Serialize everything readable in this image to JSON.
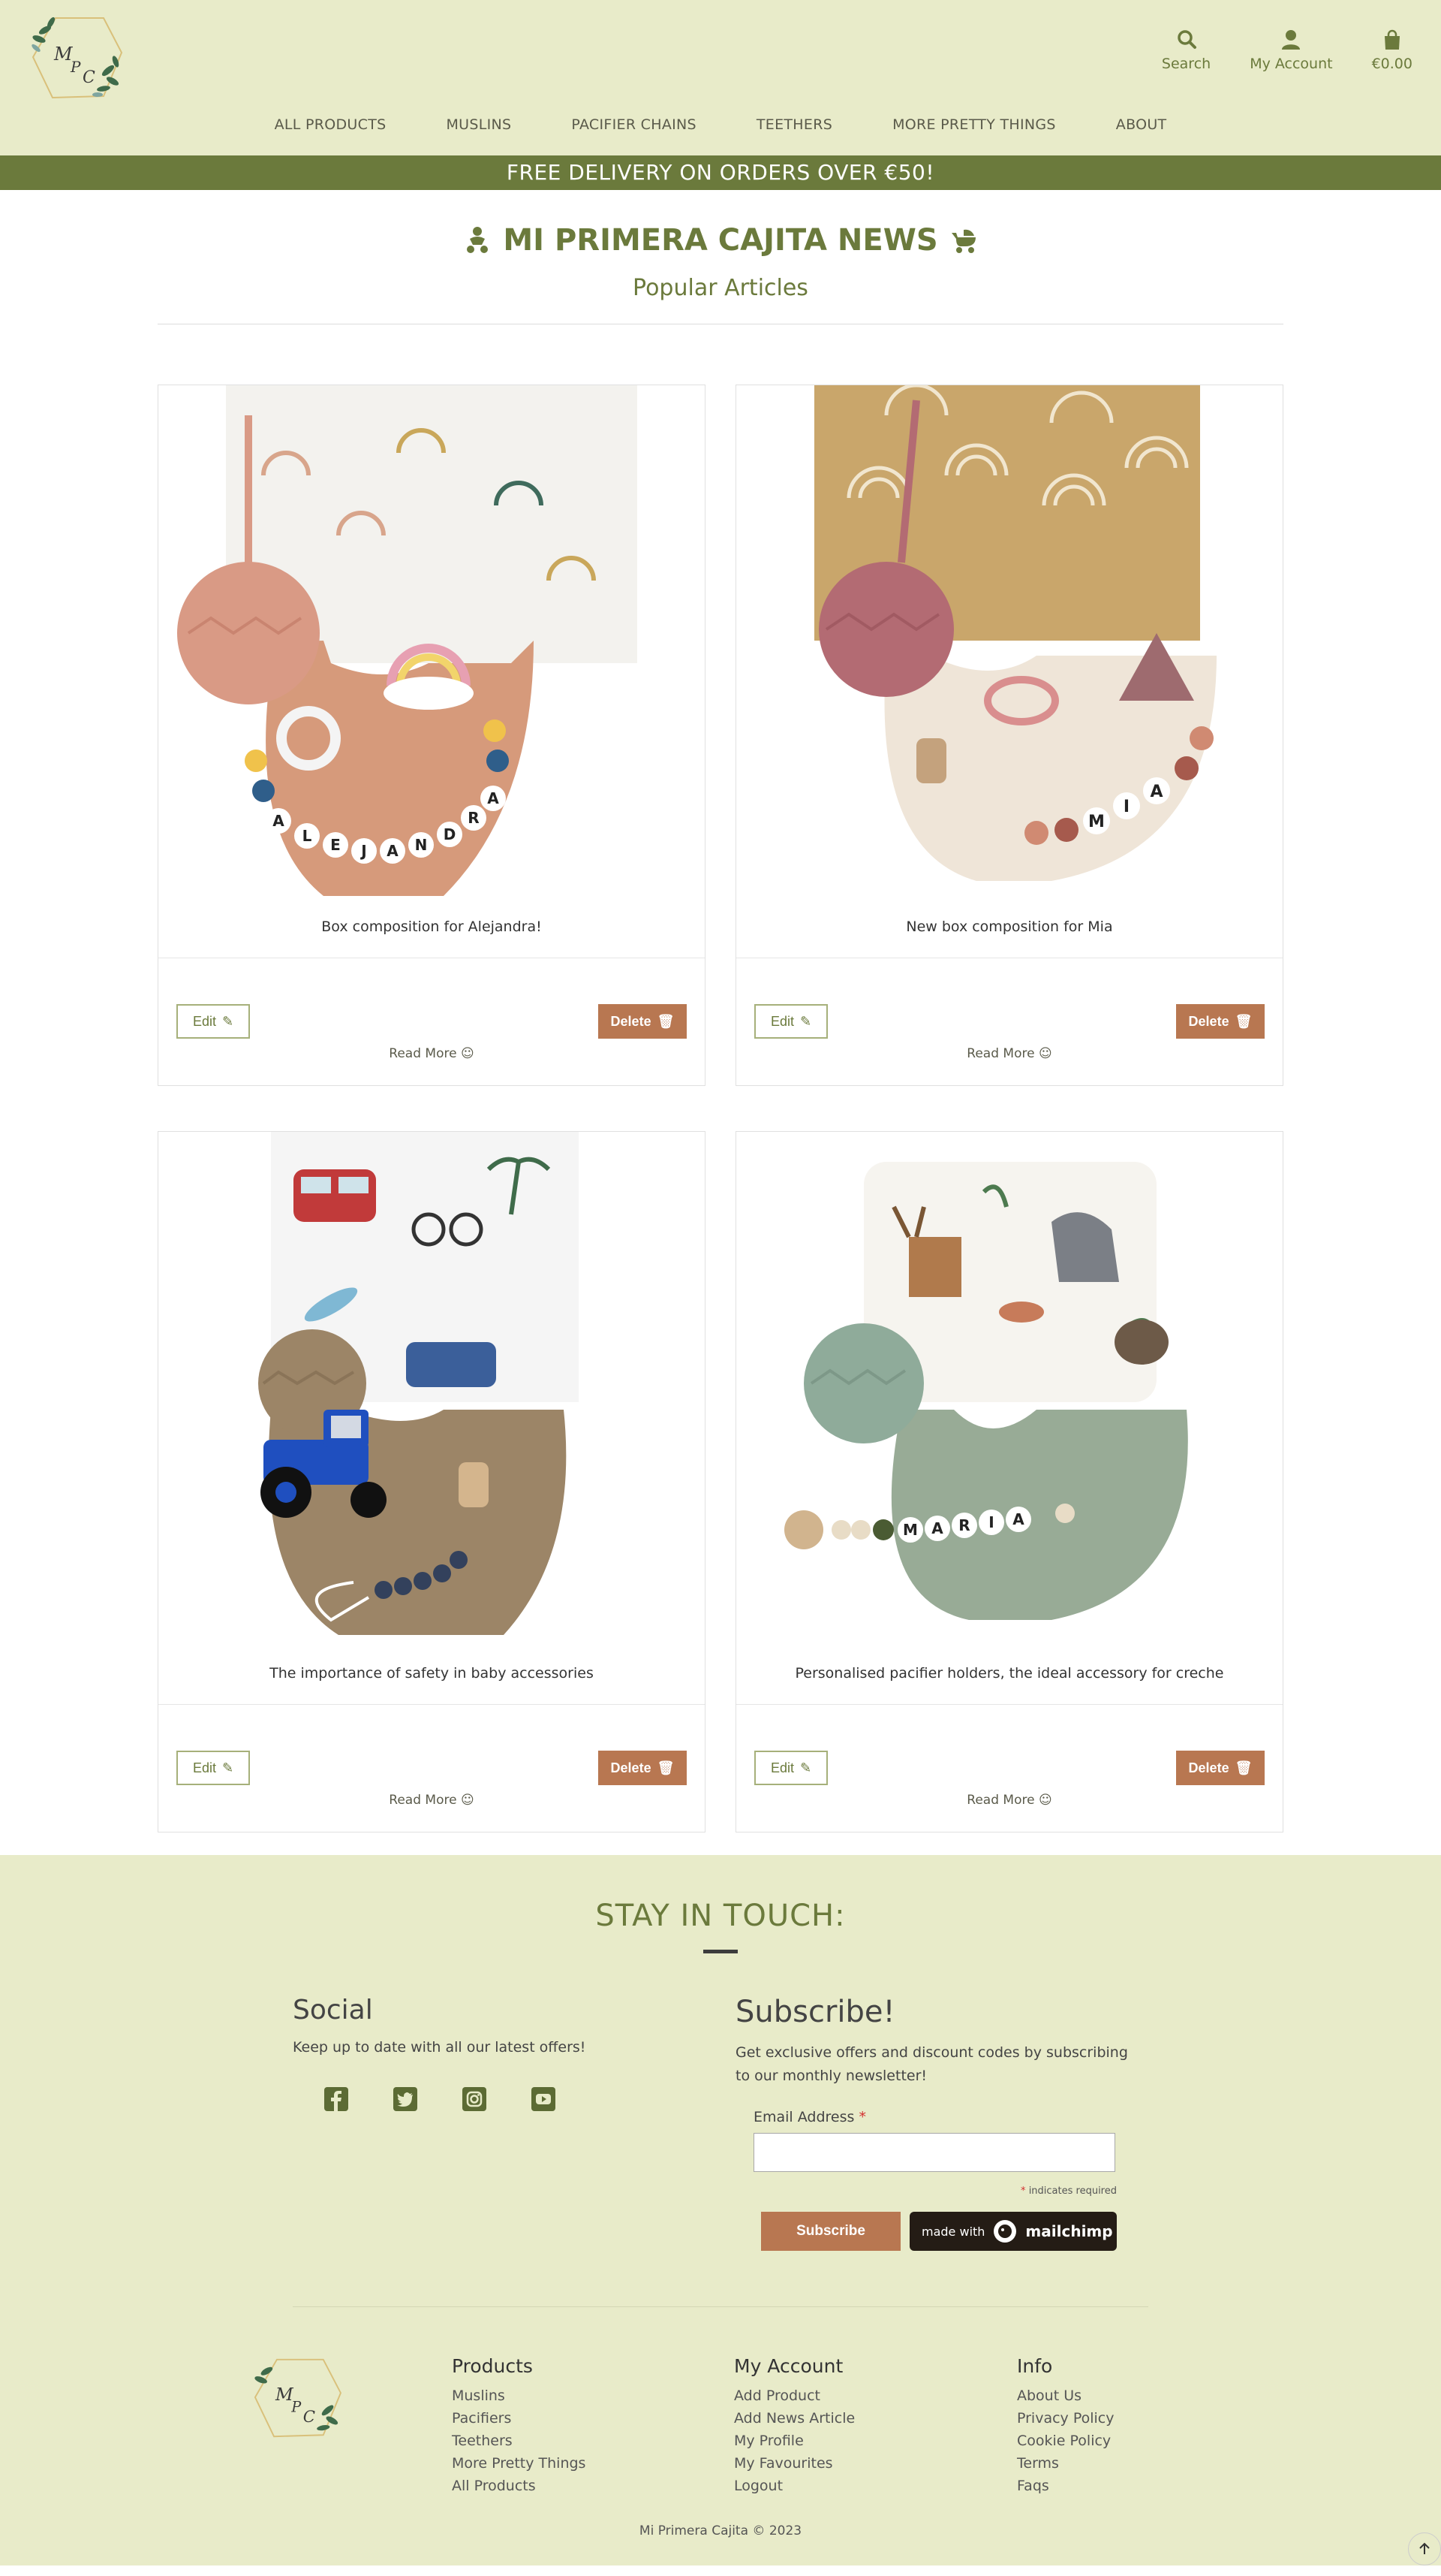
{
  "header": {
    "logo_text": "MPC",
    "actions": [
      {
        "label": "Search",
        "icon": "search-icon"
      },
      {
        "label": "My Account",
        "icon": "user-icon"
      },
      {
        "label": "€0.00",
        "icon": "shopping-bag-icon"
      }
    ],
    "nav": [
      "ALL PRODUCTS",
      "MUSLINS",
      "PACIFIER CHAINS",
      "TEETHERS",
      "MORE PRETTY THINGS",
      "ABOUT"
    ]
  },
  "promo": "FREE DELIVERY ON ORDERS OVER €50!",
  "news": {
    "title": "MI PRIMERA CAJITA NEWS",
    "subtitle": "Popular Articles"
  },
  "articles": [
    {
      "title": "Box composition for Alejandra!",
      "edit": "Edit",
      "delete": "Delete",
      "read_more": "Read More",
      "name_beads": "ALEJANDRA"
    },
    {
      "title": "New box composition for Mia",
      "edit": "Edit",
      "delete": "Delete",
      "read_more": "Read More",
      "name_beads": "MIA"
    },
    {
      "title": "The importance of safety in baby accessories",
      "edit": "Edit",
      "delete": "Delete",
      "read_more": "Read More",
      "name_beads": ""
    },
    {
      "title": "Personalised pacifier holders, the ideal accessory for creche",
      "edit": "Edit",
      "delete": "Delete",
      "read_more": "Read More",
      "name_beads": "MARIA"
    }
  ],
  "footer": {
    "stay_title": "STAY IN TOUCH:",
    "social": {
      "title": "Social",
      "text": "Keep up to date with all our latest offers!",
      "icons": [
        "facebook-icon",
        "twitter-icon",
        "instagram-icon",
        "youtube-icon"
      ]
    },
    "subscribe": {
      "title": "Subscribe!",
      "text": "Get exclusive offers and discount codes by subscribing to our monthly newsletter!",
      "email_label": "Email Address",
      "required_mark": "*",
      "required_note": "indicates required",
      "button": "Subscribe",
      "badge_prefix": "made with",
      "badge_brand": "mailchimp"
    },
    "columns": [
      {
        "title": "Products",
        "links": [
          "Muslins",
          "Pacifiers",
          "Teethers",
          "More Pretty Things",
          "All Products"
        ]
      },
      {
        "title": "My Account",
        "links": [
          "Add Product",
          "Add News Article",
          "My Profile",
          "My Favourites",
          "Logout"
        ]
      },
      {
        "title": "Info",
        "links": [
          "About Us",
          "Privacy Policy",
          "Cookie Policy",
          "Terms",
          "Faqs"
        ]
      }
    ],
    "copyright": "Mi Primera Cajita © 2023"
  },
  "colors": {
    "olive": "#6b7a3c",
    "header_bg": "#e8ebc9",
    "terracotta": "#b87751"
  }
}
